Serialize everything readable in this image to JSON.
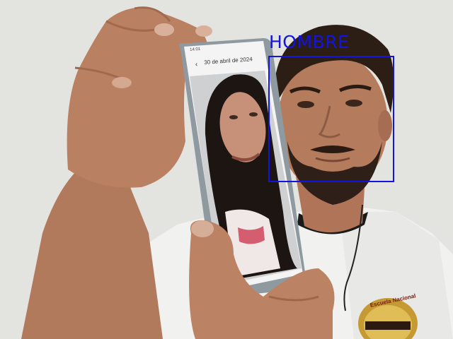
{
  "detection": {
    "label": "HOMBRE",
    "box_color": "#1414e0"
  },
  "phone_screen": {
    "status_time": "14:01",
    "date_header": "30 de abril de 2024",
    "back_icon": "arrow-left-icon"
  },
  "shirt_badge": {
    "text": "Escuela Nacional"
  },
  "colors": {
    "background_wall": "#e4e4e2",
    "skin": "#b27a5c",
    "shirt": "#f2f2f0",
    "hair": "#2a1c14",
    "detection_box": "#1414e0"
  }
}
